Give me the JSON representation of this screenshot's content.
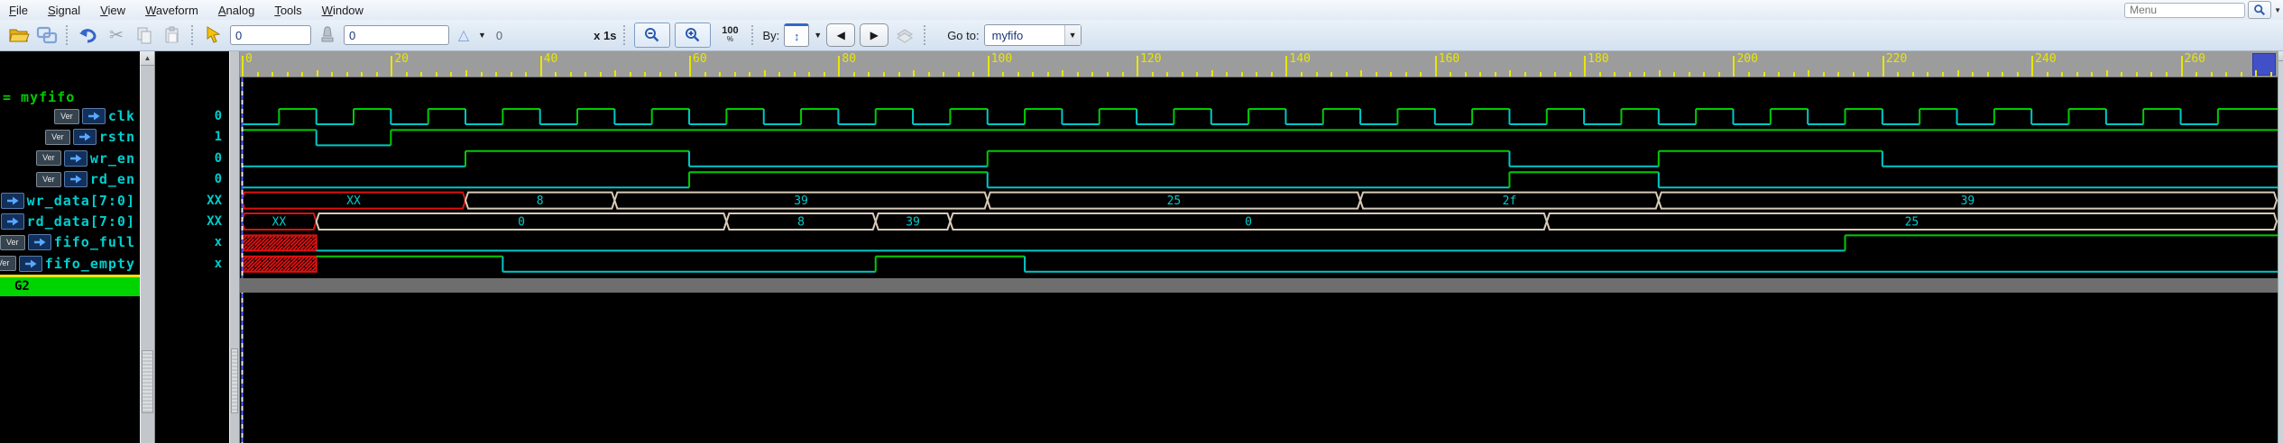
{
  "menu": {
    "items": [
      "File",
      "Signal",
      "View",
      "Waveform",
      "Analog",
      "Tools",
      "Window"
    ],
    "search_placeholder": "Menu"
  },
  "toolbar": {
    "field1_value": "0",
    "field2_value": "0",
    "delta_readout": "0",
    "scale_label": "x 1s",
    "zoom_percent_label": "100",
    "zoom_percent_suffix": "%",
    "by_label": "By:",
    "goto_label": "Go to:",
    "goto_value": "myfifo"
  },
  "signals": {
    "group": "= myfifo",
    "group2": "G2",
    "badge": "Ver",
    "rows": [
      {
        "name": "clk",
        "value": "0"
      },
      {
        "name": "rstn",
        "value": "1"
      },
      {
        "name": "wr_en",
        "value": "0"
      },
      {
        "name": "rd_en",
        "value": "0"
      },
      {
        "name": "wr_data[7:0]",
        "value": "XX"
      },
      {
        "name": "rd_data[7:0]",
        "value": "XX"
      },
      {
        "name": "fifo_full",
        "value": "x"
      },
      {
        "name": "fifo_empty",
        "value": "x"
      }
    ]
  },
  "chart_data": {
    "type": "waveform",
    "time_start": 0,
    "time_end": 273,
    "cursor_time": 0,
    "ruler": {
      "major_step": 20,
      "minor_step": 2,
      "last_label": 260
    },
    "colors": {
      "high": "#00cc00",
      "low": "#00c8c8",
      "bus_border": "#d8cbb8",
      "unknown": "#dd1111",
      "label": "#00cccc",
      "ruler_text": "#e8e600",
      "cursor_a": "#4a62ff",
      "cursor_b": "#eeeeee"
    },
    "signals": [
      {
        "name": "clk",
        "kind": "clock",
        "initial": 0,
        "first_edge": 5,
        "period_half": 5,
        "last_edge": 265
      },
      {
        "name": "rstn",
        "kind": "bit",
        "initial": 1,
        "edges": [
          [
            10,
            0
          ],
          [
            20,
            1
          ]
        ]
      },
      {
        "name": "wr_en",
        "kind": "bit",
        "initial": 0,
        "edges": [
          [
            30,
            1
          ],
          [
            60,
            0
          ],
          [
            100,
            1
          ],
          [
            170,
            0
          ],
          [
            190,
            1
          ],
          [
            220,
            0
          ]
        ]
      },
      {
        "name": "rd_en",
        "kind": "bit",
        "initial": 0,
        "edges": [
          [
            60,
            1
          ],
          [
            100,
            0
          ],
          [
            170,
            1
          ],
          [
            190,
            0
          ]
        ]
      },
      {
        "name": "wr_data[7:0]",
        "kind": "bus",
        "segments": [
          {
            "t0": 0,
            "t1": 30,
            "label": "XX",
            "unknown": true
          },
          {
            "t0": 30,
            "t1": 50,
            "label": "8"
          },
          {
            "t0": 50,
            "t1": 100,
            "label": "39"
          },
          {
            "t0": 100,
            "t1": 150,
            "label": "25"
          },
          {
            "t0": 150,
            "t1": 190,
            "label": "2f"
          },
          {
            "t0": 190,
            "t1": 273,
            "label": "39"
          }
        ]
      },
      {
        "name": "rd_data[7:0]",
        "kind": "bus",
        "segments": [
          {
            "t0": 0,
            "t1": 10,
            "label": "XX",
            "unknown": true
          },
          {
            "t0": 10,
            "t1": 65,
            "label": "0"
          },
          {
            "t0": 65,
            "t1": 85,
            "label": "8"
          },
          {
            "t0": 85,
            "t1": 95,
            "label": "39"
          },
          {
            "t0": 95,
            "t1": 175,
            "label": "0"
          },
          {
            "t0": 175,
            "t1": 273,
            "label": "25"
          }
        ]
      },
      {
        "name": "fifo_full",
        "kind": "bit",
        "unknown_until": 10,
        "initial": 0,
        "edges": [
          [
            215,
            1
          ]
        ]
      },
      {
        "name": "fifo_empty",
        "kind": "bit",
        "unknown_until": 10,
        "initial": 1,
        "edges": [
          [
            35,
            0
          ],
          [
            85,
            1
          ],
          [
            105,
            0
          ]
        ]
      }
    ]
  }
}
